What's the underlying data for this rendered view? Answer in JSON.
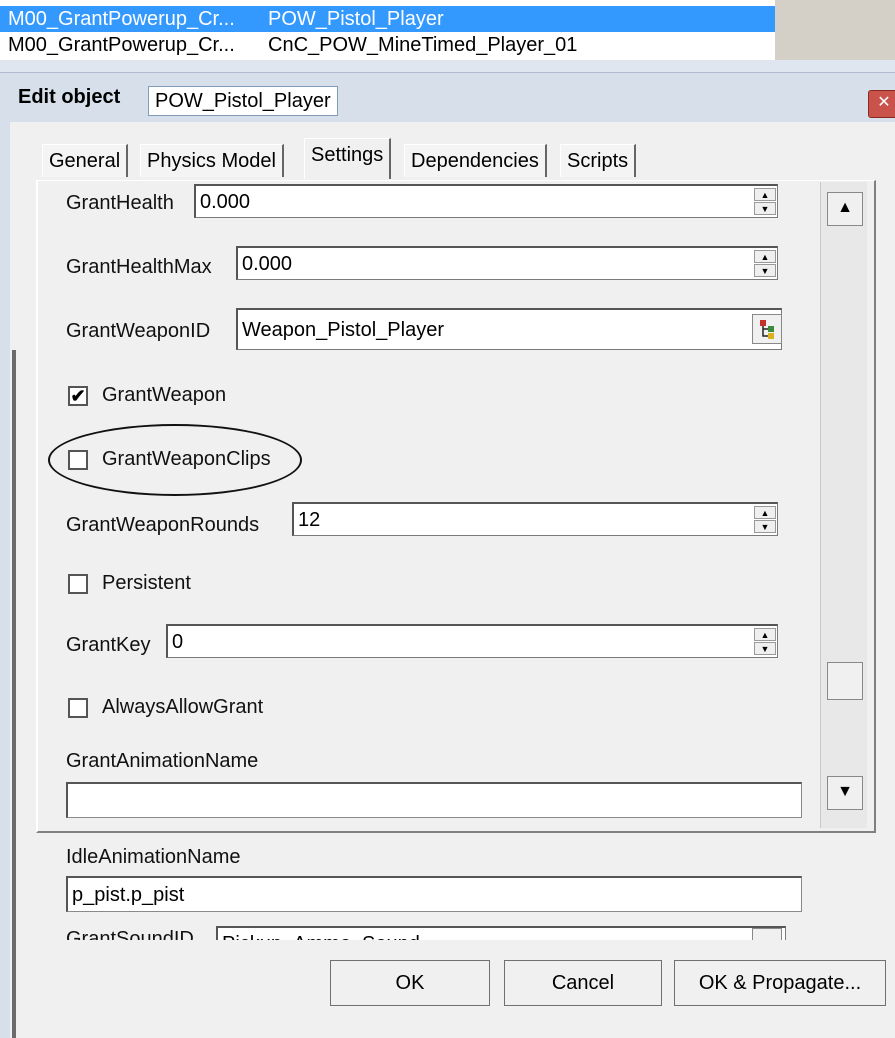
{
  "list": {
    "rows": [
      {
        "col1": "M00_GrantPowerup_Cr...",
        "col2": "POW_Pistol_Player",
        "selected": true
      },
      {
        "col1": "M00_GrantPowerup_Cr...",
        "col2": "CnC_POW_MineTimed_Player_01",
        "selected": false
      }
    ]
  },
  "dialog": {
    "title_label": "Edit object",
    "title_value": "POW_Pistol_Player",
    "close_icon": "close-icon"
  },
  "tabs": [
    {
      "label": "General"
    },
    {
      "label": "Physics Model"
    },
    {
      "label": "Settings",
      "active": true
    },
    {
      "label": "Dependencies"
    },
    {
      "label": "Scripts"
    }
  ],
  "settings": {
    "grant_health": {
      "label": "GrantHealth",
      "value": "0.000"
    },
    "grant_health_max": {
      "label": "GrantHealthMax",
      "value": "0.000"
    },
    "grant_weapon_id": {
      "label": "GrantWeaponID",
      "value": "Weapon_Pistol_Player"
    },
    "grant_weapon": {
      "label": "GrantWeapon",
      "checked": true
    },
    "grant_weapon_clips": {
      "label": "GrantWeaponClips",
      "checked": false
    },
    "grant_weapon_rounds": {
      "label": "GrantWeaponRounds",
      "value": "12"
    },
    "persistent": {
      "label": "Persistent",
      "checked": false
    },
    "grant_key": {
      "label": "GrantKey",
      "value": "0"
    },
    "always_allow_grant": {
      "label": "AlwaysAllowGrant",
      "checked": false
    },
    "grant_animation_name": {
      "label": "GrantAnimationName",
      "value": ""
    },
    "idle_animation_name": {
      "label": "IdleAnimationName",
      "value": "p_pist.p_pist"
    },
    "grant_sound_id": {
      "label": "GrantSoundID",
      "value": "Pickup_Ammo_Sound"
    }
  },
  "buttons": {
    "ok": "OK",
    "cancel": "Cancel",
    "ok_propagate": "OK & Propagate..."
  },
  "check_mark": "✔",
  "arrows": {
    "up": "▲",
    "down": "▼",
    "spin_up": "▲",
    "spin_down": "▼"
  },
  "colors": {
    "selection": "#3399ff",
    "dialog_bg": "#f0f0f0",
    "titlebar": "#d6dfea"
  }
}
